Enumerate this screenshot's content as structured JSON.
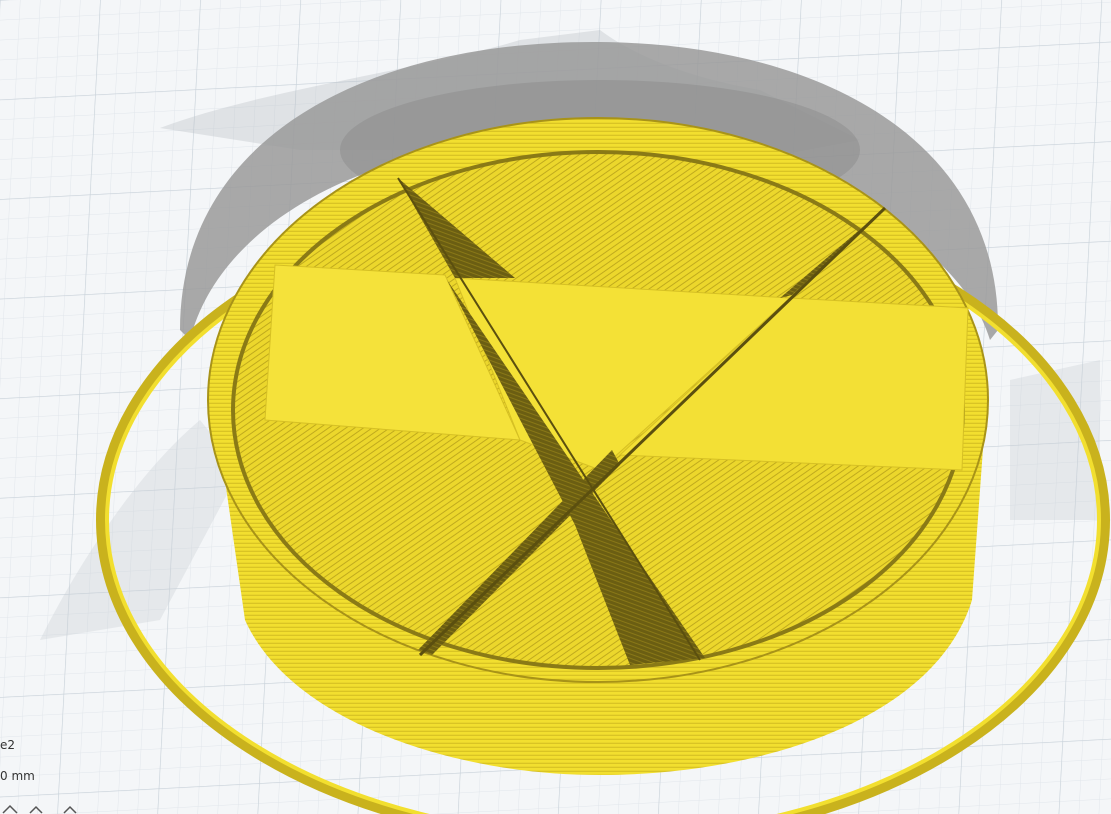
{
  "viewport": {
    "background": "#f4f6f8",
    "grid_color": "#c9d2da",
    "grid_minor_color": "#e1e6eb",
    "model_color": "#f2df2f",
    "model_shadow_color": "#c9b21d",
    "ghost_color": "#9a9a9a"
  },
  "object_info": {
    "name_fragment": "e2",
    "dimension_fragment": "0 mm"
  },
  "toolbar_icons": [
    "move-icon",
    "scale-icon",
    "rotate-icon"
  ]
}
